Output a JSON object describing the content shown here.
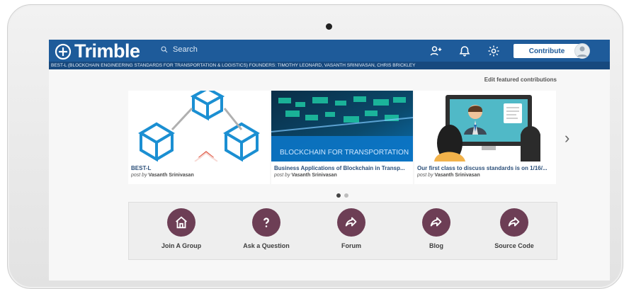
{
  "app": {
    "brand": "Trimble",
    "search_placeholder": "Search",
    "contribute_label": "Contribute",
    "subheader": "BEST-L (BLOCKCHAIN ENGINEERING STANDARDS FOR TRANSPORTATION & LOGISTICS) FOUNDERS: TIMOTHY LEONARD, VASANTH SRINIVASAN, CHRIS BRICKLEY"
  },
  "featured": {
    "edit_label": "Edit featured contributions",
    "cards": [
      {
        "title": "BEST-L",
        "post_prefix": "post by",
        "author": "Vasanth Srinivasan",
        "thumb": "cubes"
      },
      {
        "title": "Business Applications of Blockchain in Transp...",
        "post_prefix": "post by",
        "author": "Vasanth Srinivasan",
        "thumb": "network",
        "overlay_text": "BLOCKCHAIN FOR TRANSPORTATION"
      },
      {
        "title": "Our first class to discuss standards is on 1/16/...",
        "post_prefix": "post by",
        "author": "Vasanth Srinivasan",
        "thumb": "classroom"
      }
    ]
  },
  "quick_links": [
    {
      "label": "Join A Group",
      "icon": "home-icon"
    },
    {
      "label": "Ask a Question",
      "icon": "question-icon"
    },
    {
      "label": "Forum",
      "icon": "share-arrow-icon"
    },
    {
      "label": "Blog",
      "icon": "share-arrow-icon"
    },
    {
      "label": "Source Code",
      "icon": "share-arrow-icon"
    }
  ],
  "colors": {
    "topbar": "#1e5b9a",
    "accent_purple": "#6d3e55"
  }
}
